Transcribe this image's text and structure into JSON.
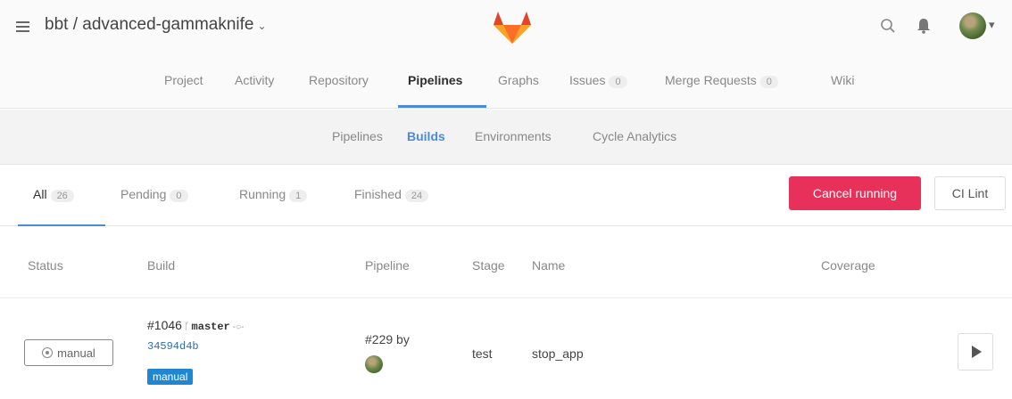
{
  "header": {
    "project": "bbt / advanced-gammaknife",
    "chevron": "⌄"
  },
  "main_nav": [
    {
      "label": "Project"
    },
    {
      "label": "Activity"
    },
    {
      "label": "Repository"
    },
    {
      "label": "Pipelines",
      "active": true
    },
    {
      "label": "Graphs"
    },
    {
      "label": "Issues",
      "count": "0"
    },
    {
      "label": "Merge Requests",
      "count": "0"
    },
    {
      "label": "Wiki"
    }
  ],
  "sub_nav": [
    {
      "label": "Pipelines"
    },
    {
      "label": "Builds",
      "active": true
    },
    {
      "label": "Environments"
    },
    {
      "label": "Cycle Analytics"
    }
  ],
  "tabs": [
    {
      "label": "All",
      "count": "26",
      "active": true
    },
    {
      "label": "Pending",
      "count": "0"
    },
    {
      "label": "Running",
      "count": "1"
    },
    {
      "label": "Finished",
      "count": "24"
    }
  ],
  "actions": {
    "cancel": "Cancel running",
    "lint": "CI Lint"
  },
  "table": {
    "headers": [
      "Status",
      "Build",
      "Pipeline",
      "Stage",
      "Name",
      "Coverage"
    ],
    "rows": [
      {
        "status": "manual",
        "build_id": "#1046",
        "branch": "master",
        "sha": "34594d4b",
        "label": "manual",
        "pipeline": "#229 by",
        "stage": "test",
        "name": "stop_app"
      }
    ]
  },
  "colors": {
    "accent": "#4a8bdb",
    "cancel": "#e8315a",
    "label": "#1f87d0"
  },
  "icons": [
    "menu-icon",
    "gitlab-logo",
    "search-icon",
    "bell-icon",
    "avatar",
    "branch-icon",
    "commit-icon",
    "gear-icon",
    "play-icon"
  ]
}
